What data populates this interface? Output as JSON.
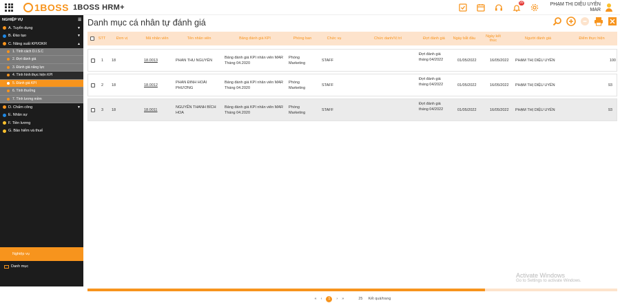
{
  "header": {
    "logo_text": "1BOSS",
    "app_name": "1BOSS HRM+",
    "notification_count": "99",
    "user_line1": "PHẠM THỊ DIỆU UYÊN",
    "user_line2": "MAR"
  },
  "sidebar": {
    "title": "NGHIỆP VỤ",
    "items": [
      {
        "label": "A. Tuyển dụng",
        "color": "orange"
      },
      {
        "label": "B. Đào tạo",
        "color": "blue"
      },
      {
        "label": "C. Năng suất KPI/OKR",
        "color": "orange"
      }
    ],
    "subitems": [
      {
        "label": "1. Tính cách D.I.S.C"
      },
      {
        "label": "2. Đợt đánh giá"
      },
      {
        "label": "3. Đánh giá năng lực"
      },
      {
        "label": "4. Tình hình thực hiện KPI"
      },
      {
        "label": "5. Đánh giá KPI"
      },
      {
        "label": "6. Tính thưởng"
      },
      {
        "label": "7. Tính lương mềm"
      }
    ],
    "items2": [
      {
        "label": "D. Chấm công",
        "color": "orange"
      },
      {
        "label": "E. Nhân sự",
        "color": "blue"
      },
      {
        "label": "F. Tiền lương",
        "color": "yellow"
      },
      {
        "label": "G. Bảo hiểm và thuế",
        "color": "yellow"
      }
    ],
    "bottom_active": "Nghiệp vụ",
    "bottom_other": "Danh mục"
  },
  "main": {
    "title": "Danh mục cá nhân tự đánh giá",
    "columns": [
      "STT",
      "Đơn vị",
      "Mã nhân viên",
      "Tên nhân viên",
      "Bảng đánh giá KPI",
      "Phòng ban",
      "Chức vụ",
      "Chức danh/Vị trí",
      "Đợt đánh giá",
      "Ngày bắt đầu",
      "Ngày kết thúc",
      "Người đánh giá",
      "Điểm thực hiện"
    ],
    "rows": [
      {
        "stt": "1",
        "unit": "18",
        "code": "18.0013",
        "name": "PHAN THU NGUYÊN",
        "kpi": "Bảng đánh giá KPI nhân viên MAR Tháng 04.2020",
        "dept": "Phòng Marketing",
        "position": "STAFF",
        "title": "",
        "period": "Đợt đánh giá tháng 04/2022",
        "start": "01/05/2022",
        "end": "16/05/2022",
        "reviewer": "PHẠM THỊ DIỆU UYÊN",
        "score": "100"
      },
      {
        "stt": "2",
        "unit": "18",
        "code": "18.0012",
        "name": "PHAN ĐINH HOÀI PHƯƠNG",
        "kpi": "Bảng đánh giá KPI nhân viên MAR Tháng 04.2020",
        "dept": "Phòng Marketing",
        "position": "STAFF",
        "title": "",
        "period": "Đợt đánh giá tháng 04/2022",
        "start": "01/05/2022",
        "end": "16/05/2022",
        "reviewer": "PHẠM THỊ DIỆU UYÊN",
        "score": "93"
      },
      {
        "stt": "3",
        "unit": "18",
        "code": "18.0011",
        "name": "NGUYỄN THANH BÍCH HOA",
        "kpi": "Bảng đánh giá KPI nhân viên MAR Tháng 04.2020",
        "dept": "Phòng Marketing",
        "position": "STAFF",
        "title": "",
        "period": "Đợt đánh giá tháng 04/2022",
        "start": "01/05/2022",
        "end": "16/05/2022",
        "reviewer": "PHẠM THỊ DIỆU UYÊN",
        "score": "93"
      }
    ]
  },
  "pager": {
    "current": "1",
    "page_size": "25",
    "page_size_label": "Kết quả/trang"
  },
  "watermark": {
    "line1": "Activate Windows",
    "line2": "Go to Settings to activate Windows."
  },
  "colors": {
    "accent": "#f7941d",
    "sidebar": "#1c1c1c",
    "header_row": "#fde3cc"
  }
}
